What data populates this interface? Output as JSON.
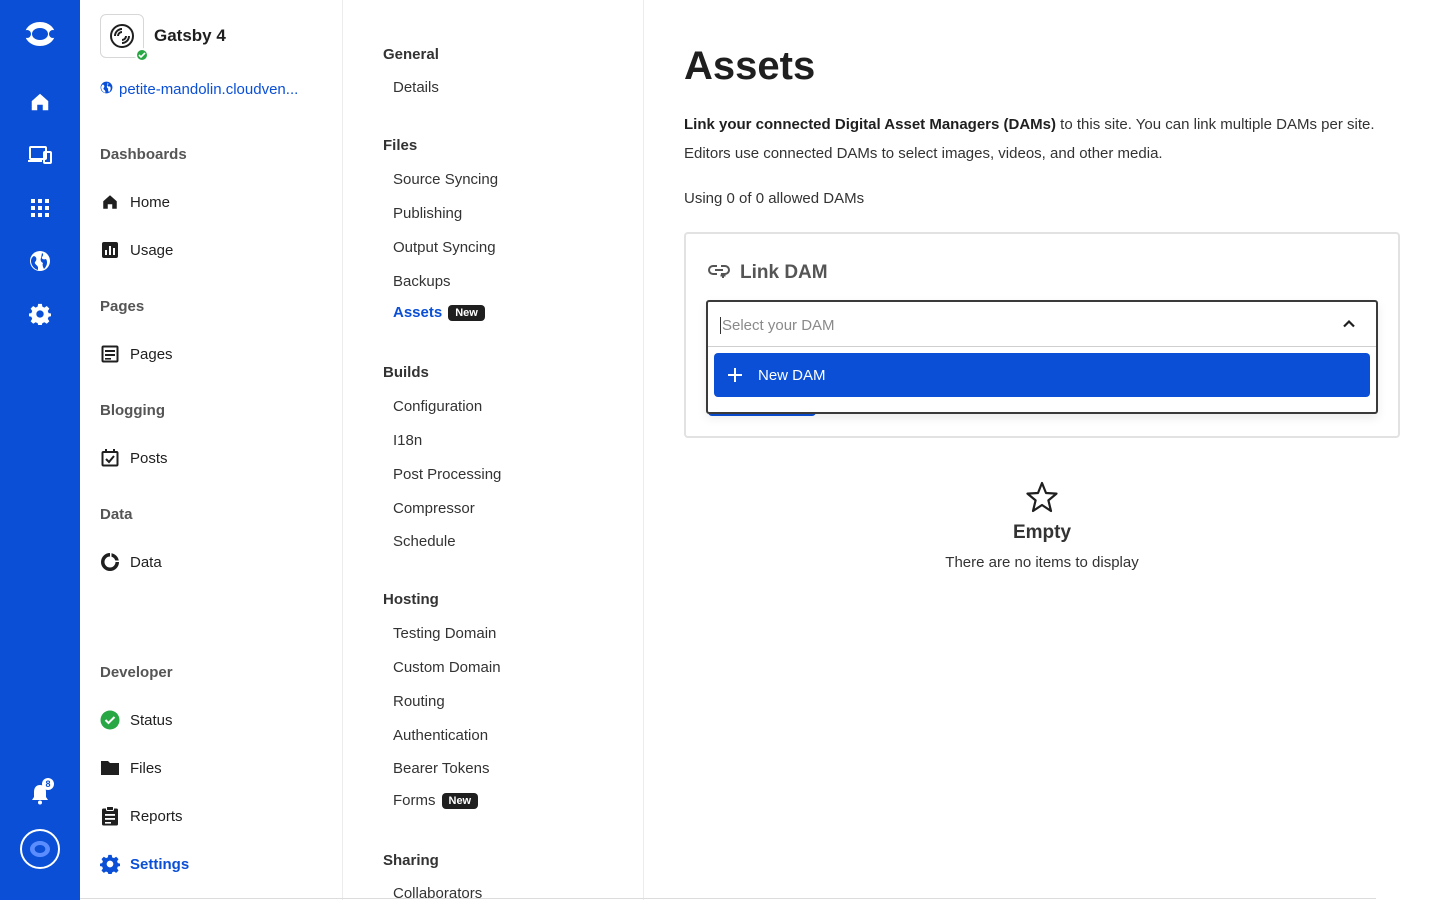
{
  "colors": {
    "brand": "#0a4fd6",
    "success": "#28a745",
    "tag_bg": "#1f1f1f"
  },
  "rail": {
    "icons": [
      "cloudcannon-logo-icon",
      "home-icon",
      "devices-icon",
      "apps-grid-icon",
      "globe-icon",
      "gear-icon",
      "bell-icon",
      "account-avatar-icon"
    ],
    "notifications_count": "8"
  },
  "site": {
    "name": "Gatsby 4",
    "url": "petite-mandolin.cloudven..."
  },
  "nav": {
    "dashboards": "Dashboards",
    "home": "Home",
    "usage": "Usage",
    "pages_section": "Pages",
    "pages": "Pages",
    "blogging": "Blogging",
    "posts": "Posts",
    "data_section": "Data",
    "data": "Data",
    "developer": "Developer",
    "status": "Status",
    "files": "Files",
    "reports": "Reports",
    "settings": "Settings"
  },
  "settings_menu": {
    "general": "General",
    "details": "Details",
    "files": "Files",
    "source_syncing": "Source Syncing",
    "publishing": "Publishing",
    "output_syncing": "Output Syncing",
    "backups": "Backups",
    "assets": "Assets",
    "new_tag": "New",
    "builds": "Builds",
    "configuration": "Configuration",
    "i18n": "I18n",
    "post_processing": "Post Processing",
    "compressor": "Compressor",
    "schedule": "Schedule",
    "hosting": "Hosting",
    "testing_domain": "Testing Domain",
    "custom_domain": "Custom Domain",
    "routing": "Routing",
    "authentication": "Authentication",
    "bearer_tokens": "Bearer Tokens",
    "forms": "Forms",
    "sharing": "Sharing",
    "collaborators": "Collaborators"
  },
  "main": {
    "title": "Assets",
    "desc_bold": "Link your connected Digital Asset Managers (DAMs)",
    "desc_rest": " to this site. You can link multiple DAMs per site. Editors use connected DAMs to select images, videos, and other media.",
    "usage": "Using 0 of 0 allowed DAMs",
    "card_title": "Link DAM",
    "select_placeholder": "Select your DAM",
    "option_new": "New DAM",
    "empty_title": "Empty",
    "empty_desc": "There are no items to display"
  }
}
